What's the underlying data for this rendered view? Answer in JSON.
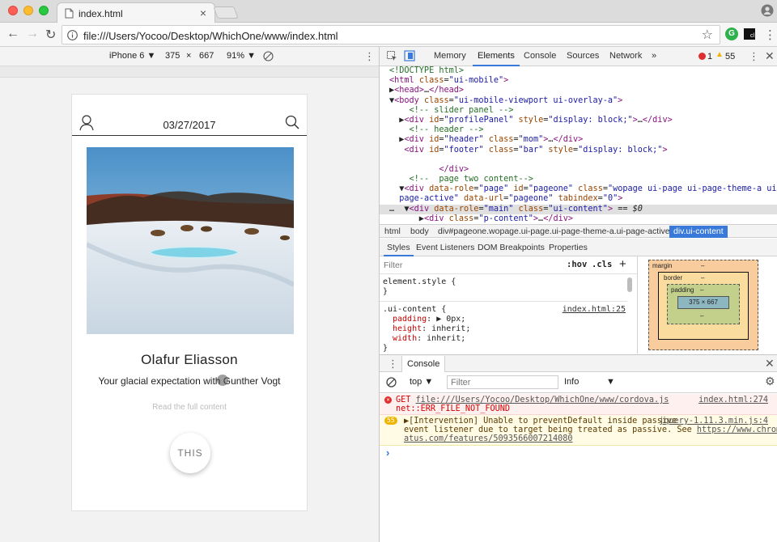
{
  "browser": {
    "tab_title": "index.html",
    "tab_close": "×",
    "url": "file:///Users/Yocoo/Desktop/WhichOne/www/index.html",
    "extension_badge": "G",
    "ext2_label": "cl"
  },
  "device_toolbar": {
    "device": "iPhone 6 ▼",
    "width": "375",
    "times": "×",
    "height": "667",
    "zoom": "91% ▼",
    "more": "⋮"
  },
  "app": {
    "date": "03/27/2017",
    "artist": "Olafur Eliasson",
    "subtitle": "Your glacial expectation with Gunther Vogt",
    "read_more": "Read the full content",
    "this_button": "THIS"
  },
  "devtools": {
    "tabs": [
      "Memory",
      "Elements",
      "Console",
      "Sources",
      "Network",
      "»"
    ],
    "active_tab": "Elements",
    "error_count": "1",
    "warning_count": "55",
    "breadcrumbs": [
      "html",
      "body",
      "div#pageone.wopage.ui-page.ui-page-theme-a.ui-page-active",
      "div.ui-content"
    ],
    "styles_tabs": [
      "Styles",
      "Event Listeners",
      "DOM Breakpoints",
      "Properties"
    ],
    "filter_placeholder": "Filter",
    "hov": ":hov",
    "cls": ".cls",
    "plus": "+",
    "element_style": "element.style {",
    "close_brace": "}",
    "rule_selector": ".ui-content {",
    "rule_source": "index.html:25",
    "rule_props": [
      {
        "name": "padding",
        "value": "▶ 0px;"
      },
      {
        "name": "height",
        "value": "inherit;"
      },
      {
        "name": "width",
        "value": "inherit;"
      }
    ],
    "box": {
      "margin": "margin",
      "border": "border",
      "padding": "padding",
      "dash": "–",
      "content": "375 × 667"
    },
    "console_tab": "Console",
    "console_context": "top",
    "console_filter": "Filter",
    "console_level": "Info",
    "errors": {
      "get_prefix": "GET",
      "get_url": "file:///Users/Yocoo/Desktop/WhichOne/www/cordova.js",
      "get_source": "index.html:274",
      "get_error": "net::ERR_FILE_NOT_FOUND",
      "intervention_count": "55",
      "intervention_line1": "▶[Intervention] Unable to preventDefault inside passive",
      "intervention_source": "jquery-1.11.3.min.js:4",
      "intervention_line2": "event listener due to target being treated as passive. See",
      "intervention_link": "https://www.chromest",
      "intervention_line3": "atus.com/features/5093566007214080",
      "prompt": "›"
    }
  },
  "colors": {
    "accent": "#3879d9",
    "error_red": "#e02d2d",
    "warning_yellow": "#f0b400",
    "tag": "#881280",
    "attr": "#994500",
    "value": "#1a1aa6",
    "comment": "#236e25"
  }
}
